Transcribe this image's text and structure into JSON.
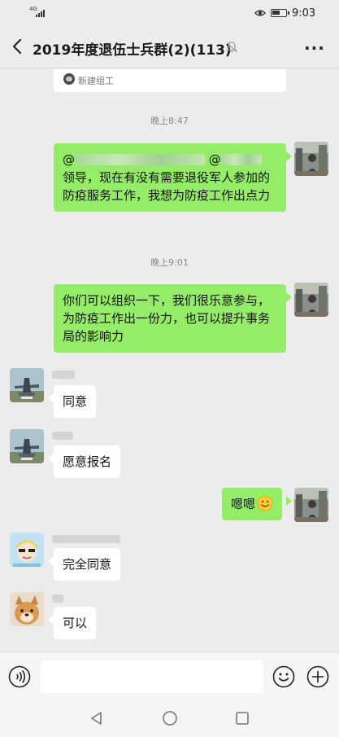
{
  "status_bar": {
    "network": "4G",
    "time": "9:03"
  },
  "header": {
    "title": "2019年度退伍士兵群(2)(113)",
    "back_icon": "chevron-left-icon",
    "mute_icon": "bell-off-icon",
    "more_label": "···"
  },
  "chat": {
    "card": {
      "text": "新建组工"
    },
    "timestamps": [
      "晚上8:47",
      "晚上9:01"
    ],
    "messages": [
      {
        "side": "right",
        "prefix_1": "@",
        "prefix_2": "@",
        "text": "领导，现在有没有需要退役军人参加的防疫服务工作，我想为防疫工作出点力"
      },
      {
        "side": "right",
        "text": "你们可以组织一下，我们很乐意参与，为防疫工作出一份力，也可以提升事务局的影响力"
      },
      {
        "side": "left",
        "text": "同意"
      },
      {
        "side": "left",
        "text": "愿意报名"
      },
      {
        "side": "right",
        "text": "嗯嗯",
        "emoji": "smile-emoji"
      },
      {
        "side": "left",
        "text": "完全同意"
      },
      {
        "side": "left",
        "text": "可以"
      }
    ]
  },
  "input_bar": {
    "voice_icon": "voice-icon",
    "emoji_icon": "emoji-icon",
    "plus_icon": "plus-icon"
  },
  "nav_bar": {
    "back_icon": "nav-back-icon",
    "home_icon": "nav-home-icon",
    "recent_icon": "nav-recent-icon"
  },
  "colors": {
    "background": "#ececec",
    "bubble_sent": "#95ec69",
    "bubble_received": "#ffffff",
    "timestamp": "#8a8a8a"
  }
}
